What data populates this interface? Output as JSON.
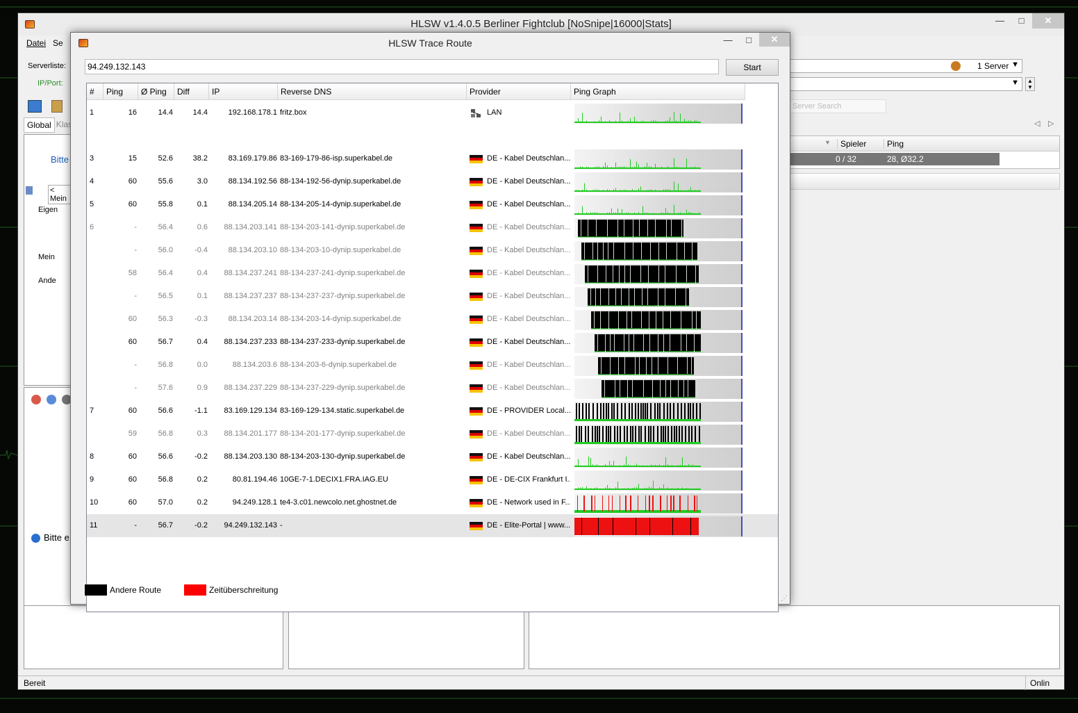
{
  "main_window": {
    "title": "HLSW v1.4.0.5   Berliner Fightclub [NoSnipe|16000|Stats]",
    "menu": [
      "Datei",
      "Se"
    ],
    "serverlist_label": "Serverliste:",
    "ipport_label": "IP/Port:",
    "tabs": [
      "Global",
      "Klass"
    ],
    "bitte_text": "Bitte",
    "dropdown_meine": "< Mein",
    "tree": [
      "Eigen",
      "Mein",
      "Ande"
    ],
    "server_count": "1 Server",
    "server_search_placeholder": "Server Search",
    "columns": {
      "spieler": "Spieler",
      "ping": "Ping"
    },
    "server_row": {
      "spieler": "0 / 32",
      "ping": "28, Ø32.2"
    },
    "bitte_info": "Bitte e",
    "status_left": "Bereit",
    "status_right": "Onlin"
  },
  "dialog": {
    "title": "HLSW Trace Route",
    "ip_value": "94.249.132.143",
    "start_label": "Start",
    "headers": [
      "#",
      "Ping",
      "Ø Ping",
      "Diff",
      "IP",
      "Reverse DNS",
      "Provider",
      "Ping Graph"
    ],
    "legend": {
      "other_route": "Andere Route",
      "timeout": "Zeitüberschreitung",
      "colors": {
        "other_route": "#000000",
        "timeout": "#ff0000",
        "ok": "#22cc22"
      }
    }
  },
  "hops": [
    {
      "num": "1",
      "ping": "16",
      "avg": "14.4",
      "diff": "14.4",
      "ip": "192.168.178.1",
      "dns": "fritz.box",
      "provider": "LAN",
      "icon": "network-icon",
      "graph": "green",
      "fill": 0.75,
      "gray": false
    },
    {
      "num": "3",
      "ping": "15",
      "avg": "52.6",
      "diff": "38.2",
      "ip": "83.169.179.86",
      "dns": "83-169-179-86-isp.superkabel.de",
      "provider": "DE - Kabel Deutschlan...",
      "icon": "flag-de-icon",
      "graph": "green",
      "fill": 0.75,
      "gray": false
    },
    {
      "num": "4",
      "ping": "60",
      "avg": "55.6",
      "diff": "3.0",
      "ip": "88.134.192.56",
      "dns": "88-134-192-56-dynip.superkabel.de",
      "provider": "DE - Kabel Deutschlan...",
      "icon": "flag-de-icon",
      "graph": "green",
      "fill": 0.75,
      "gray": false
    },
    {
      "num": "5",
      "ping": "60",
      "avg": "55.8",
      "diff": "0.1",
      "ip": "88.134.205.14",
      "dns": "88-134-205-14-dynip.superkabel.de",
      "provider": "DE - Kabel Deutschlan...",
      "icon": "flag-de-icon",
      "graph": "green",
      "fill": 0.75,
      "gray": false
    },
    {
      "num": "6",
      "ping": "-",
      "avg": "56.4",
      "diff": "0.6",
      "ip": "88.134.203.141",
      "dns": "88-134-203-141-dynip.superkabel.de",
      "provider": "DE - Kabel Deutschlan...",
      "icon": "flag-de-icon",
      "graph": "black",
      "fill": 0.65,
      "gray": true
    },
    {
      "num": "",
      "ping": "-",
      "avg": "56.0",
      "diff": "-0.4",
      "ip": "88.134.203.10",
      "dns": "88-134-203-10-dynip.superkabel.de",
      "provider": "DE - Kabel Deutschlan...",
      "icon": "flag-de-icon",
      "graph": "black",
      "fill": 0.73,
      "gray": true
    },
    {
      "num": "",
      "ping": "58",
      "avg": "56.4",
      "diff": "0.4",
      "ip": "88.134.237.241",
      "dns": "88-134-237-241-dynip.superkabel.de",
      "provider": "DE - Kabel Deutschlan...",
      "icon": "flag-de-icon",
      "graph": "black",
      "fill": 0.74,
      "gray": true
    },
    {
      "num": "",
      "ping": "-",
      "avg": "56.5",
      "diff": "0.1",
      "ip": "88.134.237.237",
      "dns": "88-134-237-237-dynip.superkabel.de",
      "provider": "DE - Kabel Deutschlan...",
      "icon": "flag-de-icon",
      "graph": "black",
      "fill": 0.68,
      "gray": true
    },
    {
      "num": "",
      "ping": "60",
      "avg": "56.3",
      "diff": "-0.3",
      "ip": "88.134.203.14",
      "dns": "88-134-203-14-dynip.superkabel.de",
      "provider": "DE - Kabel Deutschlan...",
      "icon": "flag-de-icon",
      "graph": "black",
      "fill": 0.75,
      "gray": true
    },
    {
      "num": "",
      "ping": "60",
      "avg": "56.7",
      "diff": "0.4",
      "ip": "88.134.237.233",
      "dns": "88-134-237-233-dynip.superkabel.de",
      "provider": "DE - Kabel Deutschlan...",
      "icon": "flag-de-icon",
      "graph": "black",
      "fill": 0.75,
      "gray": false
    },
    {
      "num": "",
      "ping": "-",
      "avg": "56.8",
      "diff": "0.0",
      "ip": "88.134.203.6",
      "dns": "88-134-203-6-dynip.superkabel.de",
      "provider": "DE - Kabel Deutschlan...",
      "icon": "flag-de-icon",
      "graph": "black",
      "fill": 0.71,
      "gray": true
    },
    {
      "num": "",
      "ping": "-",
      "avg": "57.6",
      "diff": "0.9",
      "ip": "88.134.237.229",
      "dns": "88-134-237-229-dynip.superkabel.de",
      "provider": "DE - Kabel Deutschlan...",
      "icon": "flag-de-icon",
      "graph": "black",
      "fill": 0.72,
      "gray": true
    },
    {
      "num": "7",
      "ping": "60",
      "avg": "56.6",
      "diff": "-1.1",
      "ip": "83.169.129.134",
      "dns": "83-169-129-134.static.superkabel.de",
      "provider": "DE - PROVIDER Local...",
      "icon": "flag-de-icon",
      "graph": "stripes",
      "fill": 0.75,
      "gray": false
    },
    {
      "num": "",
      "ping": "59",
      "avg": "56.8",
      "diff": "0.3",
      "ip": "88.134.201.177",
      "dns": "88-134-201-177-dynip.superkabel.de",
      "provider": "DE - Kabel Deutschlan...",
      "icon": "flag-de-icon",
      "graph": "stripes",
      "fill": 0.75,
      "gray": true
    },
    {
      "num": "8",
      "ping": "60",
      "avg": "56.6",
      "diff": "-0.2",
      "ip": "88.134.203.130",
      "dns": "88-134-203-130-dynip.superkabel.de",
      "provider": "DE - Kabel Deutschlan...",
      "icon": "flag-de-icon",
      "graph": "green",
      "fill": 0.75,
      "gray": false
    },
    {
      "num": "9",
      "ping": "60",
      "avg": "56.8",
      "diff": "0.2",
      "ip": "80.81.194.46",
      "dns": "10GE-7-1.DECIX1.FRA.IAG.EU",
      "provider": "DE - DE-CIX Frankfurt I...",
      "icon": "flag-de-icon",
      "graph": "green",
      "fill": 0.75,
      "gray": false
    },
    {
      "num": "10",
      "ping": "60",
      "avg": "57.0",
      "diff": "0.2",
      "ip": "94.249.128.1",
      "dns": "te4-3.c01.newcolo.net.ghostnet.de",
      "provider": "DE - Network used in F...",
      "icon": "flag-de-icon",
      "graph": "redlines",
      "fill": 0.75,
      "gray": false
    },
    {
      "num": "11",
      "ping": "-",
      "avg": "56.7",
      "diff": "-0.2",
      "ip": "94.249.132.143",
      "dns": "-",
      "provider": "DE - Elite-Portal | www....",
      "icon": "flag-de-icon",
      "graph": "red",
      "fill": 0.74,
      "gray": false,
      "selected": true
    }
  ]
}
